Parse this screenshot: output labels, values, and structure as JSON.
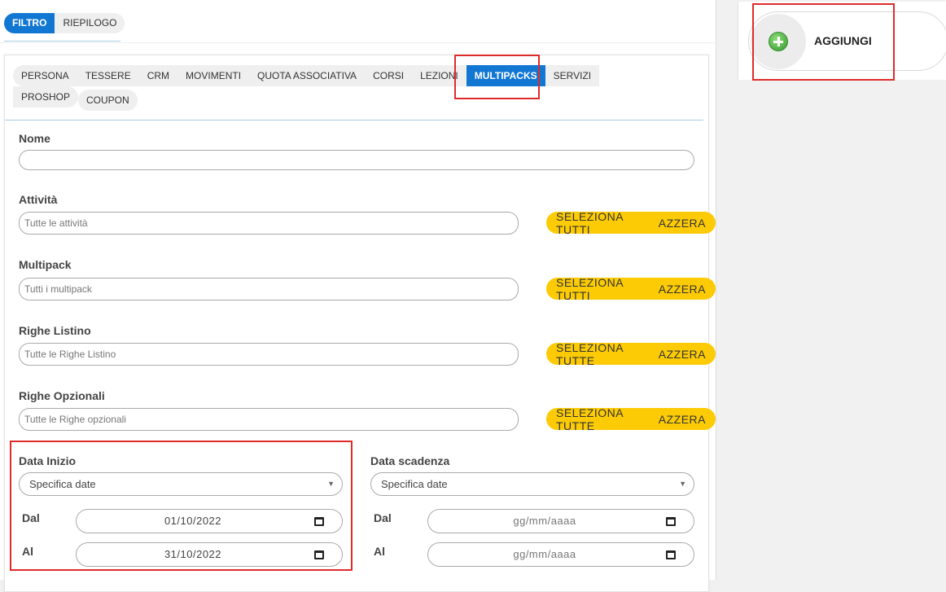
{
  "top_tabs": [
    {
      "label": "FILTRO",
      "active": true
    },
    {
      "label": "RIEPILOGO",
      "active": false
    }
  ],
  "sub_tabs": [
    {
      "label": "PERSONA"
    },
    {
      "label": "TESSERE"
    },
    {
      "label": "CRM"
    },
    {
      "label": "MOVIMENTI"
    },
    {
      "label": "QUOTA ASSOCIATIVA"
    },
    {
      "label": "CORSI"
    },
    {
      "label": "LEZIONI"
    },
    {
      "label": "MULTIPACKS",
      "active": true
    },
    {
      "label": "SERVIZI"
    },
    {
      "label": "PROSHOP"
    },
    {
      "label": "COUPON"
    }
  ],
  "form": {
    "nome": {
      "label": "Nome",
      "value": ""
    },
    "attivita": {
      "label": "Attività",
      "placeholder": "Tutte le attività",
      "select_all": "SELEZIONA TUTTI",
      "reset": "AZZERA"
    },
    "multipack": {
      "label": "Multipack",
      "placeholder": "Tutti i multipack",
      "select_all": "SELEZIONA TUTTI",
      "reset": "AZZERA"
    },
    "righe_listino": {
      "label": "Righe Listino",
      "placeholder": "Tutte le Righe Listino",
      "select_all": "SELEZIONA TUTTE",
      "reset": "AZZERA"
    },
    "righe_opzionali": {
      "label": "Righe Opzionali",
      "placeholder": "Tutte le Righe opzionali",
      "select_all": "SELEZIONA TUTTE",
      "reset": "AZZERA"
    },
    "data_inizio": {
      "label": "Data Inizio",
      "mode": "Specifica date",
      "dal_label": "Dal",
      "dal_value": "01/10/2022",
      "al_label": "Al",
      "al_value": "31/10/2022"
    },
    "data_scadenza": {
      "label": "Data scadenza",
      "mode": "Specifica date",
      "dal_label": "Dal",
      "dal_value": "gg/mm/aaaa",
      "al_label": "Al",
      "al_value": "gg/mm/aaaa"
    }
  },
  "side": {
    "add_label": "AGGIUNGI"
  },
  "icons": {
    "add": "plus-circle-icon",
    "calendar": "calendar-icon",
    "dropdown": "caret-down-icon"
  },
  "colors": {
    "primary": "#1277d3",
    "accent": "#fccb05",
    "highlight": "#e02b2b",
    "add_icon": "#2f9a29"
  }
}
